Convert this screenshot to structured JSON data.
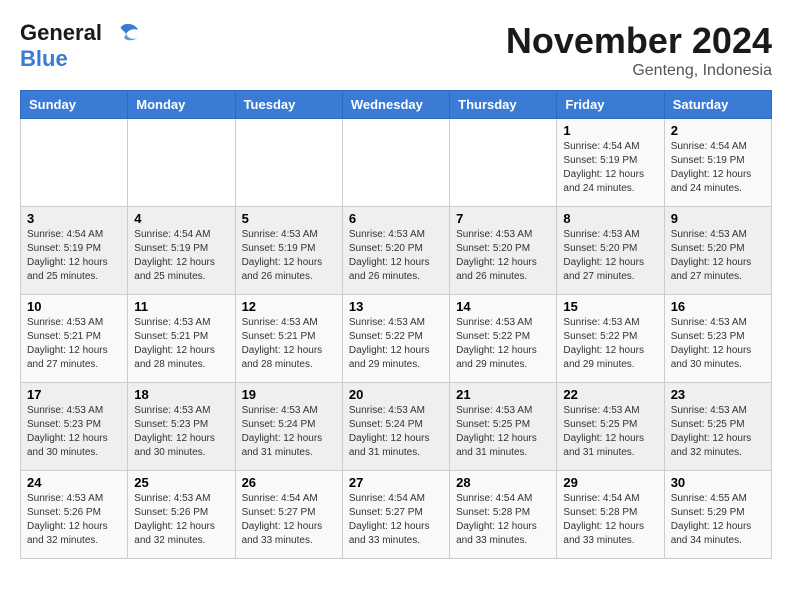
{
  "logo": {
    "line1": "General",
    "line2": "Blue"
  },
  "title": "November 2024",
  "subtitle": "Genteng, Indonesia",
  "days_of_week": [
    "Sunday",
    "Monday",
    "Tuesday",
    "Wednesday",
    "Thursday",
    "Friday",
    "Saturday"
  ],
  "weeks": [
    [
      {
        "day": "",
        "info": ""
      },
      {
        "day": "",
        "info": ""
      },
      {
        "day": "",
        "info": ""
      },
      {
        "day": "",
        "info": ""
      },
      {
        "day": "",
        "info": ""
      },
      {
        "day": "1",
        "info": "Sunrise: 4:54 AM\nSunset: 5:19 PM\nDaylight: 12 hours and 24 minutes."
      },
      {
        "day": "2",
        "info": "Sunrise: 4:54 AM\nSunset: 5:19 PM\nDaylight: 12 hours and 24 minutes."
      }
    ],
    [
      {
        "day": "3",
        "info": "Sunrise: 4:54 AM\nSunset: 5:19 PM\nDaylight: 12 hours and 25 minutes."
      },
      {
        "day": "4",
        "info": "Sunrise: 4:54 AM\nSunset: 5:19 PM\nDaylight: 12 hours and 25 minutes."
      },
      {
        "day": "5",
        "info": "Sunrise: 4:53 AM\nSunset: 5:19 PM\nDaylight: 12 hours and 26 minutes."
      },
      {
        "day": "6",
        "info": "Sunrise: 4:53 AM\nSunset: 5:20 PM\nDaylight: 12 hours and 26 minutes."
      },
      {
        "day": "7",
        "info": "Sunrise: 4:53 AM\nSunset: 5:20 PM\nDaylight: 12 hours and 26 minutes."
      },
      {
        "day": "8",
        "info": "Sunrise: 4:53 AM\nSunset: 5:20 PM\nDaylight: 12 hours and 27 minutes."
      },
      {
        "day": "9",
        "info": "Sunrise: 4:53 AM\nSunset: 5:20 PM\nDaylight: 12 hours and 27 minutes."
      }
    ],
    [
      {
        "day": "10",
        "info": "Sunrise: 4:53 AM\nSunset: 5:21 PM\nDaylight: 12 hours and 27 minutes."
      },
      {
        "day": "11",
        "info": "Sunrise: 4:53 AM\nSunset: 5:21 PM\nDaylight: 12 hours and 28 minutes."
      },
      {
        "day": "12",
        "info": "Sunrise: 4:53 AM\nSunset: 5:21 PM\nDaylight: 12 hours and 28 minutes."
      },
      {
        "day": "13",
        "info": "Sunrise: 4:53 AM\nSunset: 5:22 PM\nDaylight: 12 hours and 29 minutes."
      },
      {
        "day": "14",
        "info": "Sunrise: 4:53 AM\nSunset: 5:22 PM\nDaylight: 12 hours and 29 minutes."
      },
      {
        "day": "15",
        "info": "Sunrise: 4:53 AM\nSunset: 5:22 PM\nDaylight: 12 hours and 29 minutes."
      },
      {
        "day": "16",
        "info": "Sunrise: 4:53 AM\nSunset: 5:23 PM\nDaylight: 12 hours and 30 minutes."
      }
    ],
    [
      {
        "day": "17",
        "info": "Sunrise: 4:53 AM\nSunset: 5:23 PM\nDaylight: 12 hours and 30 minutes."
      },
      {
        "day": "18",
        "info": "Sunrise: 4:53 AM\nSunset: 5:23 PM\nDaylight: 12 hours and 30 minutes."
      },
      {
        "day": "19",
        "info": "Sunrise: 4:53 AM\nSunset: 5:24 PM\nDaylight: 12 hours and 31 minutes."
      },
      {
        "day": "20",
        "info": "Sunrise: 4:53 AM\nSunset: 5:24 PM\nDaylight: 12 hours and 31 minutes."
      },
      {
        "day": "21",
        "info": "Sunrise: 4:53 AM\nSunset: 5:25 PM\nDaylight: 12 hours and 31 minutes."
      },
      {
        "day": "22",
        "info": "Sunrise: 4:53 AM\nSunset: 5:25 PM\nDaylight: 12 hours and 31 minutes."
      },
      {
        "day": "23",
        "info": "Sunrise: 4:53 AM\nSunset: 5:25 PM\nDaylight: 12 hours and 32 minutes."
      }
    ],
    [
      {
        "day": "24",
        "info": "Sunrise: 4:53 AM\nSunset: 5:26 PM\nDaylight: 12 hours and 32 minutes."
      },
      {
        "day": "25",
        "info": "Sunrise: 4:53 AM\nSunset: 5:26 PM\nDaylight: 12 hours and 32 minutes."
      },
      {
        "day": "26",
        "info": "Sunrise: 4:54 AM\nSunset: 5:27 PM\nDaylight: 12 hours and 33 minutes."
      },
      {
        "day": "27",
        "info": "Sunrise: 4:54 AM\nSunset: 5:27 PM\nDaylight: 12 hours and 33 minutes."
      },
      {
        "day": "28",
        "info": "Sunrise: 4:54 AM\nSunset: 5:28 PM\nDaylight: 12 hours and 33 minutes."
      },
      {
        "day": "29",
        "info": "Sunrise: 4:54 AM\nSunset: 5:28 PM\nDaylight: 12 hours and 33 minutes."
      },
      {
        "day": "30",
        "info": "Sunrise: 4:55 AM\nSunset: 5:29 PM\nDaylight: 12 hours and 34 minutes."
      }
    ]
  ]
}
